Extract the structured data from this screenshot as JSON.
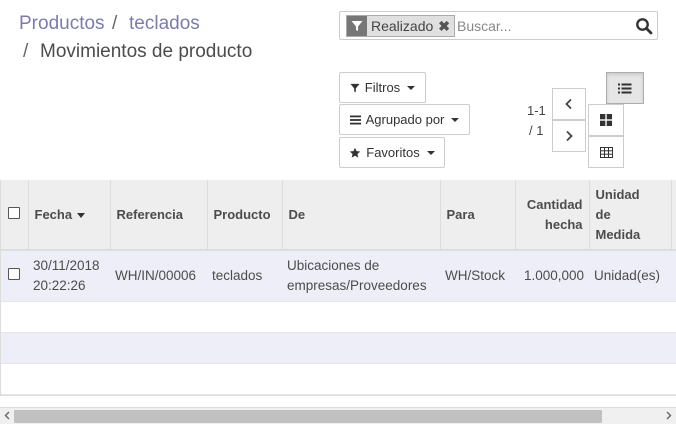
{
  "breadcrumb": {
    "items": [
      "Productos",
      "teclados"
    ],
    "separator": "/",
    "current": "Movimientos de producto"
  },
  "search": {
    "facet_value": "Realizado",
    "facet_icon": "filter-icon",
    "placeholder": "Buscar..."
  },
  "filters": {
    "filters_label": "Filtros",
    "group_label": "Agrupado por",
    "favorites_label": "Favoritos"
  },
  "pager": {
    "range": "1-1",
    "total": "/ 1"
  },
  "views": [
    "list-view-icon",
    "kanban-view-icon",
    "pivot-view-icon"
  ],
  "table": {
    "headers": {
      "date": "Fecha",
      "reference": "Referencia",
      "product": "Producto",
      "from_loc": "De",
      "to_loc": "Para",
      "qty_done_1": "Cantidad",
      "qty_done_2": "hecha",
      "uom_1": "Unidad",
      "uom_2": "de",
      "uom_3": "Medida"
    },
    "rows": [
      {
        "date_1": "30/11/2018",
        "date_2": "20:22:26",
        "reference": "WH/IN/00006",
        "product": "teclados",
        "from_1": "Ubicaciones de",
        "from_2": "empresas/Proveedores",
        "to": "WH/Stock",
        "qty": "1.000,000",
        "uom": "Unidad(es)"
      }
    ]
  },
  "colors": {
    "link": "#7c7bad",
    "row_highlight": "#eeeef8",
    "header_bg": "#eeeeee"
  }
}
